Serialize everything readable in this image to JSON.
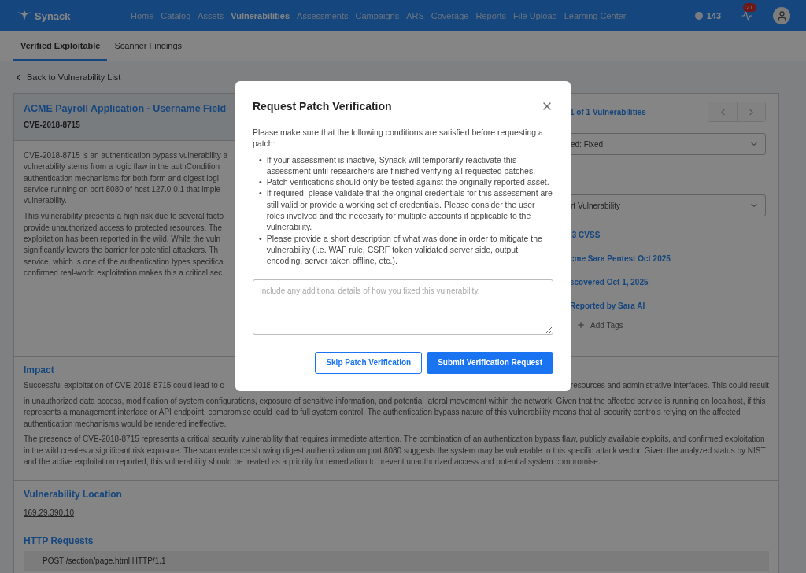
{
  "nav": {
    "brand": "Synack",
    "items": [
      {
        "label": "Home",
        "selected": false
      },
      {
        "label": "Catalog",
        "selected": false
      },
      {
        "label": "Assets",
        "selected": false
      },
      {
        "label": "Vulnerabilities",
        "selected": true
      },
      {
        "label": "Assessments",
        "selected": false
      },
      {
        "label": "Campaigns",
        "selected": false
      },
      {
        "label": "ARS",
        "selected": false
      },
      {
        "label": "Coverage",
        "selected": false
      },
      {
        "label": "Reports",
        "selected": false
      },
      {
        "label": "File Upload",
        "selected": false
      },
      {
        "label": "Learning Center",
        "selected": false
      }
    ],
    "points": "143",
    "notification_count": "21"
  },
  "tabs": [
    {
      "label": "Verified Exploitable",
      "selected": true
    },
    {
      "label": "Scanner Findings",
      "selected": false
    }
  ],
  "back_link": "Back to Vulnerability List",
  "vulnerability": {
    "title": "ACME Payroll Application - Username Field",
    "cve": "CVE-2018-8715",
    "description": [
      [
        "CVE-2018-8715 is an authentication bypass vulnerability a",
        "vulnerability stems from a logic flaw in the authCondition",
        "authentication mechanisms for both form and digest logi",
        "service running on port 8080 of host 127.0.0.1 that imple",
        "vulnerability."
      ],
      [
        "This vulnerability presents a high risk due to several facto",
        "provide unauthorized access to protected resources. The",
        "exploitation has been reported in the wild. While the vuln",
        "significantly lowers the barrier for potential attackers. Th",
        "service, which is one of the authentication types specifica",
        "confirmed real-world exploitation makes this a critical sec"
      ]
    ],
    "counter": "1 of 1 Vulnerabilities",
    "status_select": "ed: Fixed",
    "type_select": "rt Vulnerability",
    "details": [
      ".3 CVSS",
      "cme Sara Pentest Oct 2025",
      "scovered Oct 1, 2025",
      "Reported by Sara AI"
    ],
    "add_tags": "Add Tags"
  },
  "impact": {
    "heading": "Impact",
    "first_line_left": "Successful exploitation of CVE-2018-8715 could lead to c",
    "first_line_right": "resources and administrative interfaces. This could result",
    "paragraphs": [
      "in unauthorized data access, modification of system configurations, exposure of sensitive information, and potential lateral movement within the network. Given that the affected service is running on localhost, if this represents a management interface or API endpoint, compromise could lead to full system control. The authentication bypass nature of this vulnerability means that all security controls relying on the affected authentication mechanisms would be rendered ineffective.",
      "The presence of CVE-2018-8715 represents a critical security vulnerability that requires immediate attention. The combination of an authentication bypass flaw, publicly available exploits, and confirmed exploitation in the wild creates a significant risk exposure. The scan evidence showing digest authentication on port 8080 suggests the system may be vulnerable to this specific attack vector. Given the analyzed status by NIST and the active exploitation reported, this vulnerability should be treated as a priority for remediation to prevent unauthorized access and potential system compromise."
    ]
  },
  "location": {
    "heading": "Vulnerability Location",
    "address": "169.29.390.10"
  },
  "http_requests": {
    "heading": "HTTP Requests",
    "lines": [
      "POST /section/page.html HTTP/1.1"
    ]
  },
  "modal": {
    "title": "Request Patch Verification",
    "bullet": "•",
    "intro": "Please make sure that the following conditions are satisfied before requesting a patch:",
    "conditions": [
      "If your assessment is inactive, Synack will temporarily reactivate this assessment until researchers are finished verifying all requested patches.",
      "Patch verifications should only be tested against the originally reported asset.",
      "If required, please validate that the original credentials for this assessment are still valid or provide a working set of credentials. Please consider the user roles involved and the necessity for multiple accounts if applicable to the vulnerability.",
      "Please provide a short description of what was done in order to mitigate the vulnerability (i.e. WAF rule, CSRF token validated server side, output encoding, server taken offline, etc.)."
    ],
    "placeholder": "Include any additional details of how you fixed this vulnerability.",
    "buttons": [
      {
        "label": "Skip Patch Verification",
        "kind": "secondary"
      },
      {
        "label": "Submit Verification Request",
        "kind": "primary"
      }
    ]
  }
}
